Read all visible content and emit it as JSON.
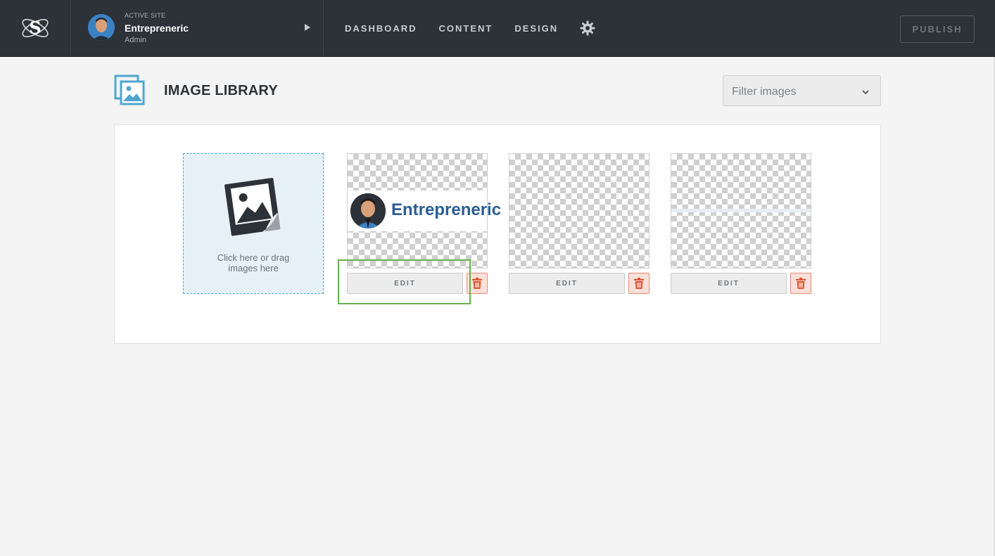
{
  "topbar": {
    "active_site_label": "ACTIVE SITE",
    "site_name": "Entrepreneric",
    "site_role": "Admin",
    "nav": [
      "DASHBOARD",
      "CONTENT",
      "DESIGN"
    ],
    "publish_label": "PUBLISH"
  },
  "page": {
    "title": "IMAGE LIBRARY",
    "filter_placeholder": "Filter images"
  },
  "library": {
    "dropzone_text_line1": "Click here or drag",
    "dropzone_text_line2": "images here",
    "logo_text": "Entrepreneric",
    "edit_label": "EDIT"
  },
  "colors": {
    "topbar_bg": "#2d3138",
    "accent_blue": "#4ea6cf",
    "delete_red": "#e0522f",
    "highlight_green": "#6ab04c"
  },
  "icons": [
    "brand-logo-icon",
    "play-arrow-icon",
    "gear-icon",
    "image-library-icon",
    "chevron-down-icon",
    "photo-upload-icon",
    "trash-icon"
  ]
}
